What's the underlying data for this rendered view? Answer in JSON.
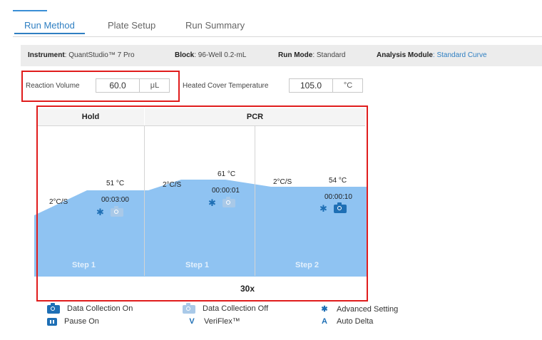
{
  "tabs": [
    "Run Method",
    "Plate Setup",
    "Run Summary"
  ],
  "info": {
    "instrument_label": "Instrument",
    "instrument_value": ": QuantStudio™ 7 Pro",
    "block_label": "Block",
    "block_value": ": 96-Well 0.2-mL",
    "run_mode_label": "Run Mode",
    "run_mode_value": ": Standard",
    "analysis_label": "Analysis Module",
    "analysis_value": ": Standard Curve"
  },
  "reaction_volume": {
    "label": "Reaction Volume",
    "value": "60.0",
    "unit": "μL"
  },
  "heated_cover": {
    "label": "Heated Cover Temperature",
    "value": "105.0",
    "unit": "°C"
  },
  "stages": [
    {
      "name": "Hold",
      "steps": [
        {
          "label": "Step 1",
          "temperature": "51 °C",
          "time": "00:03:00",
          "ramp": "2°C/S",
          "data_collection": "off"
        }
      ]
    },
    {
      "name": "PCR",
      "cycles": "30x",
      "steps": [
        {
          "label": "Step 1",
          "temperature": "61 °C",
          "time": "00:00:01",
          "ramp": "2°C/S",
          "data_collection": "off"
        },
        {
          "label": "Step 2",
          "temperature": "54 °C",
          "time": "00:00:10",
          "ramp": "2°C/S",
          "data_collection": "on"
        }
      ]
    }
  ],
  "legend": {
    "data_on": "Data Collection On",
    "data_off": "Data Collection Off",
    "advanced": "Advanced Setting",
    "pause": "Pause On",
    "veriflex_letter": "V",
    "veriflex": "VeriFlex™",
    "autodelta_letter": "A",
    "autodelta": "Auto Delta"
  },
  "colors": {
    "accent": "#2f7fc2",
    "fill": "#8fc3f2",
    "highlight": "#e01c1c",
    "icon": "#1e6fb5"
  }
}
